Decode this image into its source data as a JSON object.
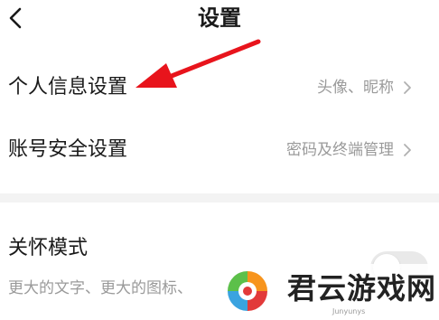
{
  "header": {
    "title": "设置",
    "back_icon": "chevron-left-icon"
  },
  "settings": {
    "items": [
      {
        "label": "个人信息设置",
        "value": "头像、昵称",
        "icon": "chevron-right-icon"
      },
      {
        "label": "账号安全设置",
        "value": "密码及终端管理",
        "icon": "chevron-right-icon"
      }
    ]
  },
  "care_mode": {
    "title": "关怀模式",
    "description": "更大的文字、更大的图标、",
    "enabled": false
  },
  "annotation": {
    "arrow_color": "#e8141c"
  },
  "watermark": {
    "name": "君云游戏网",
    "sub": "Junyunys"
  },
  "colors": {
    "primary_text": "#1a1a1a",
    "secondary_text": "#9a9a9a",
    "divider": "#f3f3f3"
  }
}
